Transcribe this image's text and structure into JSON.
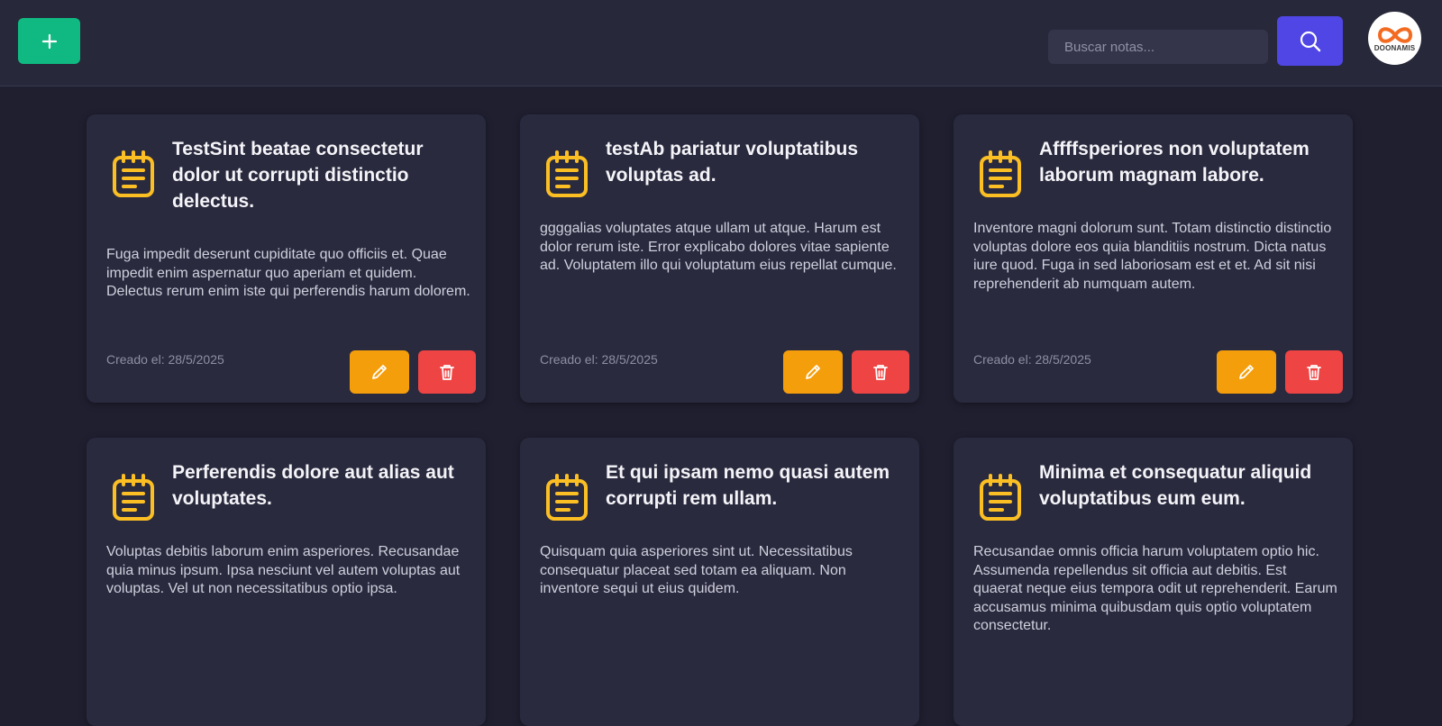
{
  "header": {
    "add_label": "+",
    "search": {
      "placeholder": "Buscar notas...",
      "value": ""
    },
    "avatar_text": "DOONAMIS"
  },
  "colors": {
    "add": "#10b981",
    "search": "#4f46e5",
    "edit": "#f59e0b",
    "delete": "#ef4444",
    "note_icon": "#fbbf24"
  },
  "icons": {
    "add": "plus-icon",
    "search": "search-icon",
    "note": "notepad-icon",
    "edit": "pencil-icon",
    "delete": "trash-icon",
    "avatar": "infinity-logo-icon"
  },
  "notes": [
    {
      "title": "TestSint beatae consectetur dolor ut corrupti distinctio delectus.",
      "body": "Fuga impedit deserunt cupiditate quo officiis et. Quae impedit enim aspernatur quo aperiam et quidem. Delectus rerum enim iste qui perferendis harum dolorem.",
      "date": "Creado el: 28/5/2025"
    },
    {
      "title": "testAb pariatur voluptatibus voluptas ad.",
      "body": "ggggalias voluptates atque ullam ut atque. Harum est dolor rerum iste. Error explicabo dolores vitae sapiente ad. Voluptatem illo qui voluptatum eius repellat cumque.",
      "date": "Creado el: 28/5/2025"
    },
    {
      "title": "Affffsperiores non voluptatem laborum magnam labore.",
      "body": "Inventore magni dolorum sunt. Totam distinctio distinctio voluptas dolore eos quia blanditiis nostrum. Dicta natus iure quod. Fuga in sed laboriosam est et et. Ad sit nisi reprehenderit ab numquam autem.",
      "date": "Creado el: 28/5/2025"
    },
    {
      "title": "Perferendis dolore aut alias aut voluptates.",
      "body": "Voluptas debitis laborum enim asperiores. Recusandae quia minus ipsum. Ipsa nesciunt vel autem voluptas aut voluptas. Vel ut non necessitatibus optio ipsa."
    },
    {
      "title": "Et qui ipsam nemo quasi autem corrupti rem ullam.",
      "body": "Quisquam quia asperiores sint ut. Necessitatibus consequatur placeat sed totam ea aliquam. Non inventore sequi ut eius quidem."
    },
    {
      "title": "Minima et consequatur aliquid voluptatibus eum eum.",
      "body": "Recusandae omnis officia harum voluptatem optio hic. Assumenda repellendus sit officia aut debitis. Est quaerat neque eius tempora odit ut reprehenderit. Earum accusamus minima quibusdam quis optio voluptatem consectetur."
    }
  ]
}
